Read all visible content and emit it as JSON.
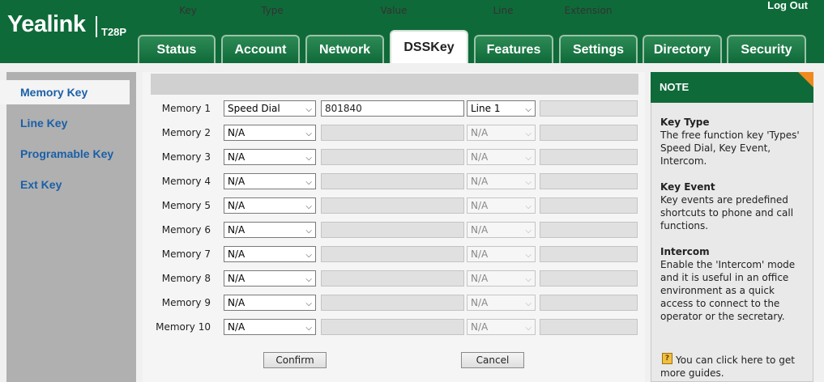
{
  "header": {
    "brand": "Yealink",
    "model": "T28P",
    "logout": "Log Out"
  },
  "tabs": [
    {
      "label": "Status"
    },
    {
      "label": "Account"
    },
    {
      "label": "Network"
    },
    {
      "label": "DSSKey",
      "active": true
    },
    {
      "label": "Features"
    },
    {
      "label": "Settings"
    },
    {
      "label": "Directory"
    },
    {
      "label": "Security"
    }
  ],
  "sidebar": {
    "items": [
      {
        "label": "Memory Key",
        "active": true
      },
      {
        "label": "Line Key"
      },
      {
        "label": "Programable Key"
      },
      {
        "label": "Ext Key"
      }
    ]
  },
  "table": {
    "headers": {
      "key": "Key",
      "type": "Type",
      "value": "Value",
      "line": "Line",
      "extension": "Extension"
    },
    "rows": [
      {
        "key": "Memory 1",
        "type": "Speed Dial",
        "value": "801840",
        "line": "Line 1",
        "extension": ""
      },
      {
        "key": "Memory 2",
        "type": "N/A",
        "value": "",
        "line": "N/A",
        "extension": ""
      },
      {
        "key": "Memory 3",
        "type": "N/A",
        "value": "",
        "line": "N/A",
        "extension": ""
      },
      {
        "key": "Memory 4",
        "type": "N/A",
        "value": "",
        "line": "N/A",
        "extension": ""
      },
      {
        "key": "Memory 5",
        "type": "N/A",
        "value": "",
        "line": "N/A",
        "extension": ""
      },
      {
        "key": "Memory 6",
        "type": "N/A",
        "value": "",
        "line": "N/A",
        "extension": ""
      },
      {
        "key": "Memory 7",
        "type": "N/A",
        "value": "",
        "line": "N/A",
        "extension": ""
      },
      {
        "key": "Memory 8",
        "type": "N/A",
        "value": "",
        "line": "N/A",
        "extension": ""
      },
      {
        "key": "Memory 9",
        "type": "N/A",
        "value": "",
        "line": "N/A",
        "extension": ""
      },
      {
        "key": "Memory 10",
        "type": "N/A",
        "value": "",
        "line": "N/A",
        "extension": ""
      }
    ]
  },
  "buttons": {
    "confirm": "Confirm",
    "cancel": "Cancel"
  },
  "note": {
    "heading": "NOTE",
    "sections": [
      {
        "title": "Key Type",
        "text": "The free function key 'Types' Speed Dial, Key Event, Intercom."
      },
      {
        "title": "Key Event",
        "text": "Key events are predefined shortcuts to phone and call functions."
      },
      {
        "title": "Intercom",
        "text": "Enable the 'Intercom' mode and it is useful in an office environment as a quick access to connect to the operator or the secretary."
      }
    ],
    "guide": "You can click here to get more guides."
  },
  "icons": {
    "guide": "help-book-icon",
    "dropdown": "chevron-down-icon"
  },
  "colors": {
    "brand_green": "#0f6a39",
    "accent_orange": "#f08a1e",
    "link_blue": "#1a5fa8"
  }
}
